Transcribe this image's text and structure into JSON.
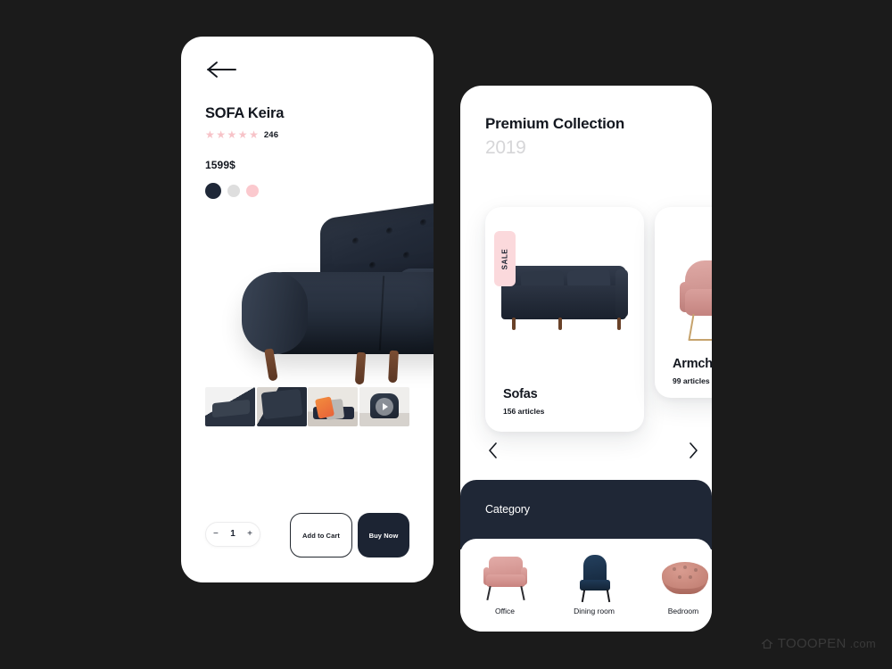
{
  "canvas": {
    "background": "#1b1b1b"
  },
  "detail_screen": {
    "back_icon": "arrow-left-icon",
    "product_title": "SOFA Keira",
    "rating": {
      "stars": 5,
      "filled": 5,
      "count": "246",
      "star_color": "#f7c3c8"
    },
    "price": "1599$",
    "colors": [
      {
        "name": "navy",
        "hex": "#1f2838",
        "selected": true
      },
      {
        "name": "light-grey",
        "hex": "#dedede",
        "selected": false
      },
      {
        "name": "pink",
        "hex": "#fbc9ce",
        "selected": false
      }
    ],
    "thumbnails": [
      {
        "name": "sofa-bed-flat"
      },
      {
        "name": "sofa-closeup"
      },
      {
        "name": "sofa-styled-throw"
      },
      {
        "name": "armchair-video",
        "has_play": true
      }
    ],
    "quantity": {
      "decrement": "−",
      "value": "1",
      "increment": "+"
    },
    "add_to_cart_label": "Add to Cart",
    "buy_now_label": "Buy Now"
  },
  "collection_screen": {
    "title": "Premium Collection",
    "year": "2019",
    "cards": [
      {
        "badge": "SALE",
        "label": "Sofas",
        "articles": "156 articles",
        "image": "navy-sofa"
      },
      {
        "badge": "",
        "label": "Armchairs",
        "articles": "99 articles",
        "image": "pink-armchair"
      }
    ],
    "prev_arrow": "chevron-left-icon",
    "next_arrow": "chevron-right-icon",
    "category": {
      "title": "Category",
      "items": [
        {
          "label": "Office",
          "image": "pink-armchair"
        },
        {
          "label": "Dining room",
          "image": "navy-wing-chair"
        },
        {
          "label": "Bedroom",
          "image": "pink-ottoman"
        }
      ]
    }
  },
  "watermark": {
    "brand": "TOOOPEN",
    "suffix": ".com",
    "icon": "house-icon"
  }
}
